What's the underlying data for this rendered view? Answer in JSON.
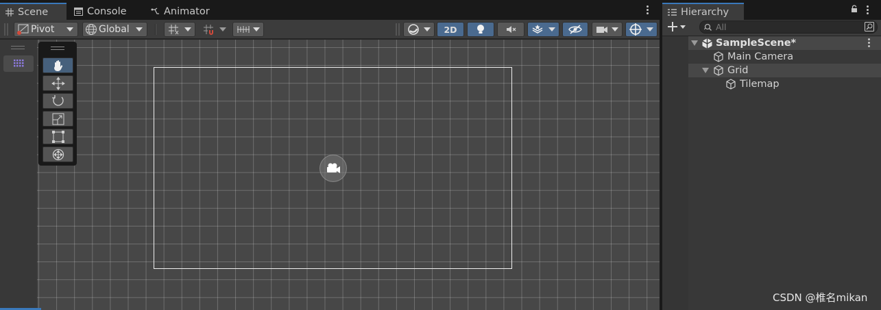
{
  "scene_tabs": [
    {
      "label": "Scene",
      "icon": "grid-icon"
    },
    {
      "label": "Console",
      "icon": "console-icon"
    },
    {
      "label": "Animator",
      "icon": "animator-icon"
    }
  ],
  "toolbar": {
    "pivot_label": "Pivot",
    "global_label": "Global",
    "mode_2d_label": "2D"
  },
  "tools": [
    "hand-tool",
    "move-tool",
    "rotate-tool",
    "scale-tool",
    "rect-tool",
    "transform-tool"
  ],
  "hierarchy": {
    "tab_label": "Hierarchy",
    "search_placeholder": "All",
    "items": [
      {
        "label": "SampleScene*",
        "depth": 0,
        "type": "scene",
        "expanded": true
      },
      {
        "label": "Main Camera",
        "depth": 1,
        "type": "gameobject"
      },
      {
        "label": "Grid",
        "depth": 1,
        "type": "gameobject",
        "expanded": true
      },
      {
        "label": "Tilemap",
        "depth": 2,
        "type": "gameobject"
      }
    ]
  },
  "watermark": "CSDN @椎名mikan",
  "colors": {
    "accent": "#3a79bb",
    "active_button": "#4a6a8f",
    "viewport_bg": "#474747"
  }
}
